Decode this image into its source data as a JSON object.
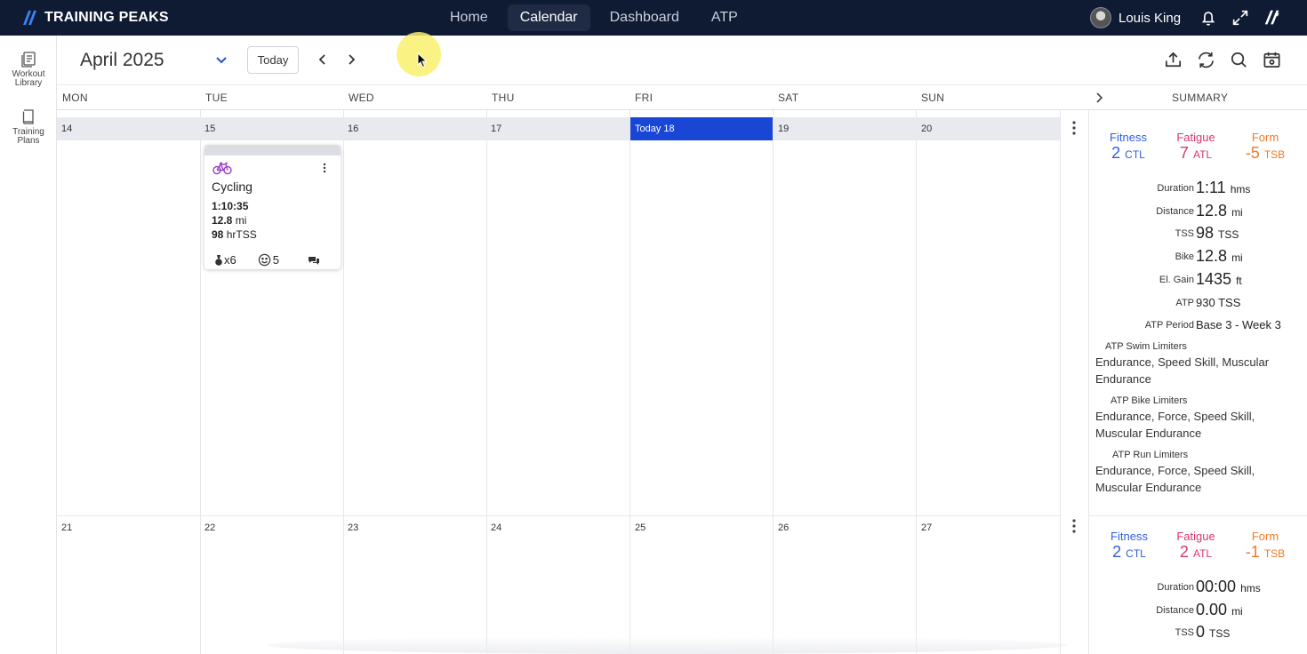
{
  "brand": {
    "name": "TRAINING PEAKS"
  },
  "nav": {
    "items": [
      "Home",
      "Calendar",
      "Dashboard",
      "ATP"
    ],
    "active": "Calendar"
  },
  "user": {
    "name": "Louis King"
  },
  "sidebar": {
    "workout_library": "Workout Library",
    "training_plans": "Training Plans"
  },
  "toolbar": {
    "month": "April 2025",
    "today_label": "Today"
  },
  "weekdays": [
    "MON",
    "TUE",
    "WED",
    "THU",
    "FRI",
    "SAT",
    "SUN"
  ],
  "summary_title": "SUMMARY",
  "weeks": [
    {
      "dates": [
        "14",
        "15",
        "16",
        "17",
        "Today 18",
        "19",
        "20"
      ]
    },
    {
      "dates": [
        "21",
        "22",
        "23",
        "24",
        "25",
        "26",
        "27"
      ]
    }
  ],
  "workout": {
    "title": "Cycling",
    "duration": "1:10:35",
    "distance_value": "12.8",
    "distance_unit": "mi",
    "tss_value": "98",
    "tss_unit": "hrTSS",
    "medals": "x6",
    "feel": "5"
  },
  "summaries": [
    {
      "fitness_label": "Fitness",
      "fitness_value": "2",
      "fitness_unit": "CTL",
      "fatigue_label": "Fatigue",
      "fatigue_value": "7",
      "fatigue_unit": "ATL",
      "form_label": "Form",
      "form_value": "-5",
      "form_unit": "TSB",
      "rows": [
        {
          "key": "Duration",
          "value": "1:11",
          "unit": "hms"
        },
        {
          "key": "Distance",
          "value": "12.8",
          "unit": "mi"
        },
        {
          "key": "TSS",
          "value": "98",
          "unit": "TSS"
        },
        {
          "key": "Bike",
          "value": "12.8",
          "unit": "mi"
        },
        {
          "key": "El. Gain",
          "value": "1435",
          "unit": "ft"
        },
        {
          "key": "ATP",
          "value": "930",
          "unit": "TSS"
        },
        {
          "key": "ATP Period",
          "value": "Base 3 - Week 3",
          "unit": ""
        }
      ],
      "limiters": [
        {
          "title": "ATP Swim Limiters",
          "text": "Endurance, Speed Skill, Muscular Endurance"
        },
        {
          "title": "ATP Bike Limiters",
          "text": "Endurance, Force, Speed Skill, Muscular Endurance"
        },
        {
          "title": "ATP Run Limiters",
          "text": "Endurance, Force, Speed Skill, Muscular Endurance"
        }
      ]
    },
    {
      "fitness_label": "Fitness",
      "fitness_value": "2",
      "fitness_unit": "CTL",
      "fatigue_label": "Fatigue",
      "fatigue_value": "2",
      "fatigue_unit": "ATL",
      "form_label": "Form",
      "form_value": "-1",
      "form_unit": "TSB",
      "rows": [
        {
          "key": "Duration",
          "value": "00:00",
          "unit": "hms"
        },
        {
          "key": "Distance",
          "value": "0.00",
          "unit": "mi"
        },
        {
          "key": "TSS",
          "value": "0",
          "unit": "TSS"
        }
      ]
    }
  ],
  "colors": {
    "navbar": "#0f1a33",
    "today": "#1a46d6",
    "fitness": "#2f5fe0",
    "fatigue": "#d63a6a",
    "form": "#ef7a2a"
  }
}
